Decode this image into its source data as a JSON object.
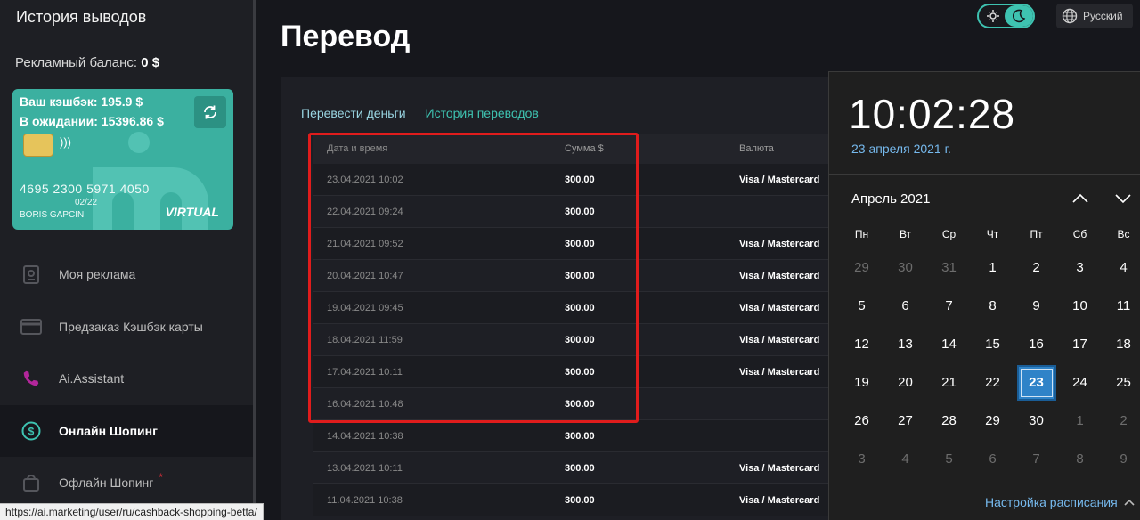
{
  "sidebar": {
    "title": "История выводов",
    "balance_label": "Рекламный баланс:",
    "balance_value": "0 $",
    "card": {
      "cashback": "Ваш кэшбэк: 195.9 $",
      "pending": "В ожидании: 15396.86 $",
      "number": "4695 2300 5971 4050",
      "expiry": "02/22",
      "holder": "BORIS GAPCIN",
      "type": "VIRTUAL"
    },
    "nav": [
      {
        "label": "Моя реклама",
        "icon": "badge-icon"
      },
      {
        "label": "Предзаказ Кэшбэк карты",
        "icon": "credit-card-icon"
      },
      {
        "label": "Ai.Assistant",
        "icon": "phone-icon"
      },
      {
        "label": "Онлайн Шопинг",
        "icon": "dollar-circle-icon"
      },
      {
        "label": "Офлайн Шопинг",
        "icon": "shopping-bag-icon",
        "badge": "*"
      }
    ]
  },
  "status_url": "https://ai.marketing/user/ru/cashback-shopping-betta/",
  "main": {
    "title": "Перевод",
    "tabs": [
      "Перевести деньги",
      "История переводов"
    ],
    "table": {
      "headers": [
        "Дата и время",
        "Сумма $",
        "Валюта"
      ],
      "rows": [
        [
          "23.04.2021 10:02",
          "300.00",
          "Visa / Mastercard"
        ],
        [
          "22.04.2021 09:24",
          "300.00",
          ""
        ],
        [
          "21.04.2021 09:52",
          "300.00",
          "Visa / Mastercard"
        ],
        [
          "20.04.2021 10:47",
          "300.00",
          "Visa / Mastercard"
        ],
        [
          "19.04.2021 09:45",
          "300.00",
          "Visa / Mastercard"
        ],
        [
          "18.04.2021 11:59",
          "300.00",
          "Visa / Mastercard"
        ],
        [
          "17.04.2021 10:11",
          "300.00",
          "Visa / Mastercard"
        ],
        [
          "16.04.2021 10:48",
          "300.00",
          ""
        ],
        [
          "14.04.2021 10:38",
          "300.00",
          ""
        ],
        [
          "13.04.2021 10:11",
          "300.00",
          "Visa / Mastercard"
        ],
        [
          "11.04.2021 10:38",
          "300.00",
          "Visa / Mastercard"
        ]
      ]
    }
  },
  "topbar": {
    "language": "Русский"
  },
  "colors": {
    "accent": "#3ec3b1",
    "highlight": "#e01c1c",
    "today": "#2f83c8"
  },
  "calendar": {
    "time": "10:02:28",
    "date": "23 апреля 2021 г.",
    "month": "Апрель 2021",
    "weekdays": [
      "Пн",
      "Вт",
      "Ср",
      "Чт",
      "Пт",
      "Сб",
      "Вс"
    ],
    "days": [
      {
        "d": "29",
        "m": true
      },
      {
        "d": "30",
        "m": true
      },
      {
        "d": "31",
        "m": true
      },
      {
        "d": "1"
      },
      {
        "d": "2"
      },
      {
        "d": "3"
      },
      {
        "d": "4"
      },
      {
        "d": "5"
      },
      {
        "d": "6"
      },
      {
        "d": "7"
      },
      {
        "d": "8"
      },
      {
        "d": "9"
      },
      {
        "d": "10"
      },
      {
        "d": "11"
      },
      {
        "d": "12"
      },
      {
        "d": "13"
      },
      {
        "d": "14"
      },
      {
        "d": "15"
      },
      {
        "d": "16"
      },
      {
        "d": "17"
      },
      {
        "d": "18"
      },
      {
        "d": "19"
      },
      {
        "d": "20"
      },
      {
        "d": "21"
      },
      {
        "d": "22"
      },
      {
        "d": "23",
        "t": true
      },
      {
        "d": "24"
      },
      {
        "d": "25"
      },
      {
        "d": "26"
      },
      {
        "d": "27"
      },
      {
        "d": "28"
      },
      {
        "d": "29"
      },
      {
        "d": "30"
      },
      {
        "d": "1",
        "m": true
      },
      {
        "d": "2",
        "m": true
      },
      {
        "d": "3",
        "m": true
      },
      {
        "d": "4",
        "m": true
      },
      {
        "d": "5",
        "m": true
      },
      {
        "d": "6",
        "m": true
      },
      {
        "d": "7",
        "m": true
      },
      {
        "d": "8",
        "m": true
      },
      {
        "d": "9",
        "m": true
      }
    ],
    "footer": "Настройка расписания"
  }
}
